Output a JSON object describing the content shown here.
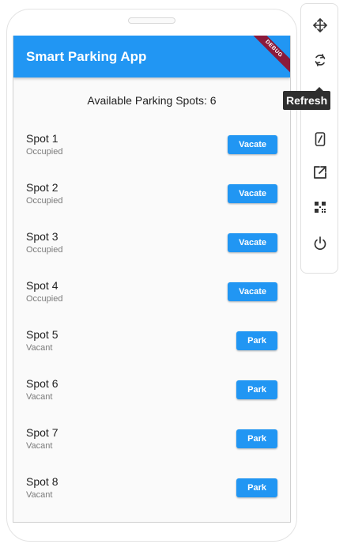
{
  "app": {
    "title": "Smart Parking App",
    "debug_banner": "DEBUG",
    "available_label": "Available Parking Spots: 6"
  },
  "spots": [
    {
      "name": "Spot 1",
      "status": "Occupied",
      "button": "Vacate"
    },
    {
      "name": "Spot 2",
      "status": "Occupied",
      "button": "Vacate"
    },
    {
      "name": "Spot 3",
      "status": "Occupied",
      "button": "Vacate"
    },
    {
      "name": "Spot 4",
      "status": "Occupied",
      "button": "Vacate"
    },
    {
      "name": "Spot 5",
      "status": "Vacant",
      "button": "Park"
    },
    {
      "name": "Spot 6",
      "status": "Vacant",
      "button": "Park"
    },
    {
      "name": "Spot 7",
      "status": "Vacant",
      "button": "Park"
    },
    {
      "name": "Spot 8",
      "status": "Vacant",
      "button": "Park"
    }
  ],
  "toolbar": {
    "tools": [
      "move-icon",
      "refresh-icon",
      "rotate-device-icon",
      "open-external-icon",
      "qr-code-icon",
      "power-icon"
    ],
    "tooltip": "Refresh"
  },
  "colors": {
    "accent": "#2196f3",
    "debug_banner": "#8b1a3b",
    "tooltip_bg": "#2f2f2f"
  }
}
